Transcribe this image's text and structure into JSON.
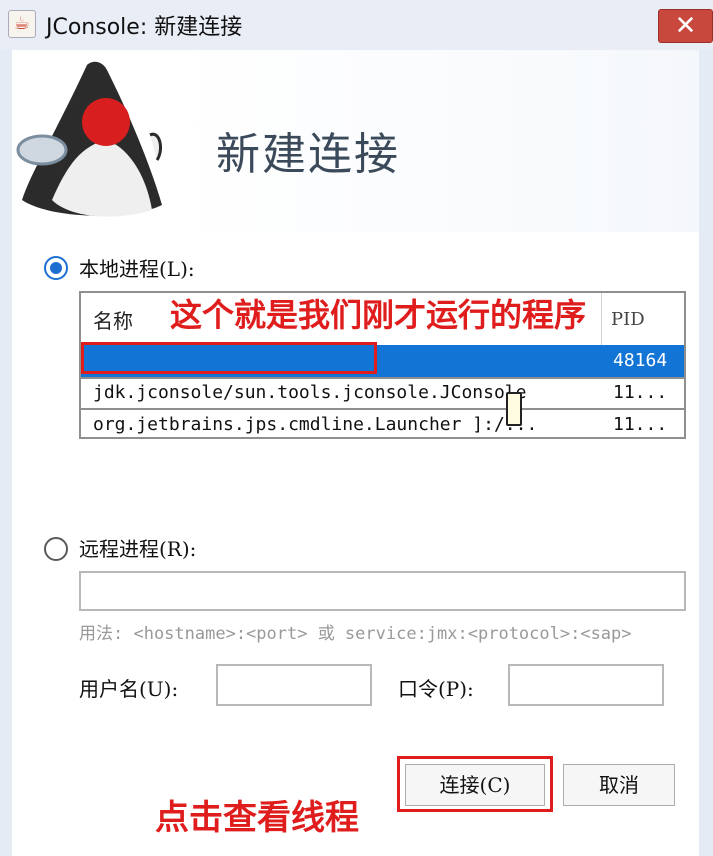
{
  "window": {
    "title": "JConsole: 新建连接",
    "app_icon": "java-coffee-icon",
    "close_icon": "✕"
  },
  "banner": {
    "title": "新建连接",
    "logo": "duke-mascot"
  },
  "local": {
    "label": "本地进程(L):",
    "selected": true,
    "columns": {
      "name": "名称",
      "pid": "PID"
    },
    "rows": [
      {
        "name": "",
        "pid": "48164",
        "selected": true
      },
      {
        "name": "jdk.jconsole/sun.tools.jconsole.JConsole",
        "pid": "11...",
        "selected": false
      },
      {
        "name": "org.jetbrains.jps.cmdline.Launcher ]:/...",
        "pid": "11...",
        "selected": false
      }
    ]
  },
  "remote": {
    "label": "远程进程(R):",
    "selected": false,
    "address_value": "",
    "usage_hint": "用法: <hostname>:<port> 或 service:jmx:<protocol>:<sap>",
    "username_label": "用户名(U):",
    "username_value": "",
    "password_label": "口令(P):",
    "password_value": ""
  },
  "buttons": {
    "connect": "连接(C)",
    "cancel": "取消"
  },
  "annotations": {
    "program_note": "这个就是我们刚才运行的程序",
    "connect_note": "点击查看线程",
    "color": "#e01d1d"
  }
}
